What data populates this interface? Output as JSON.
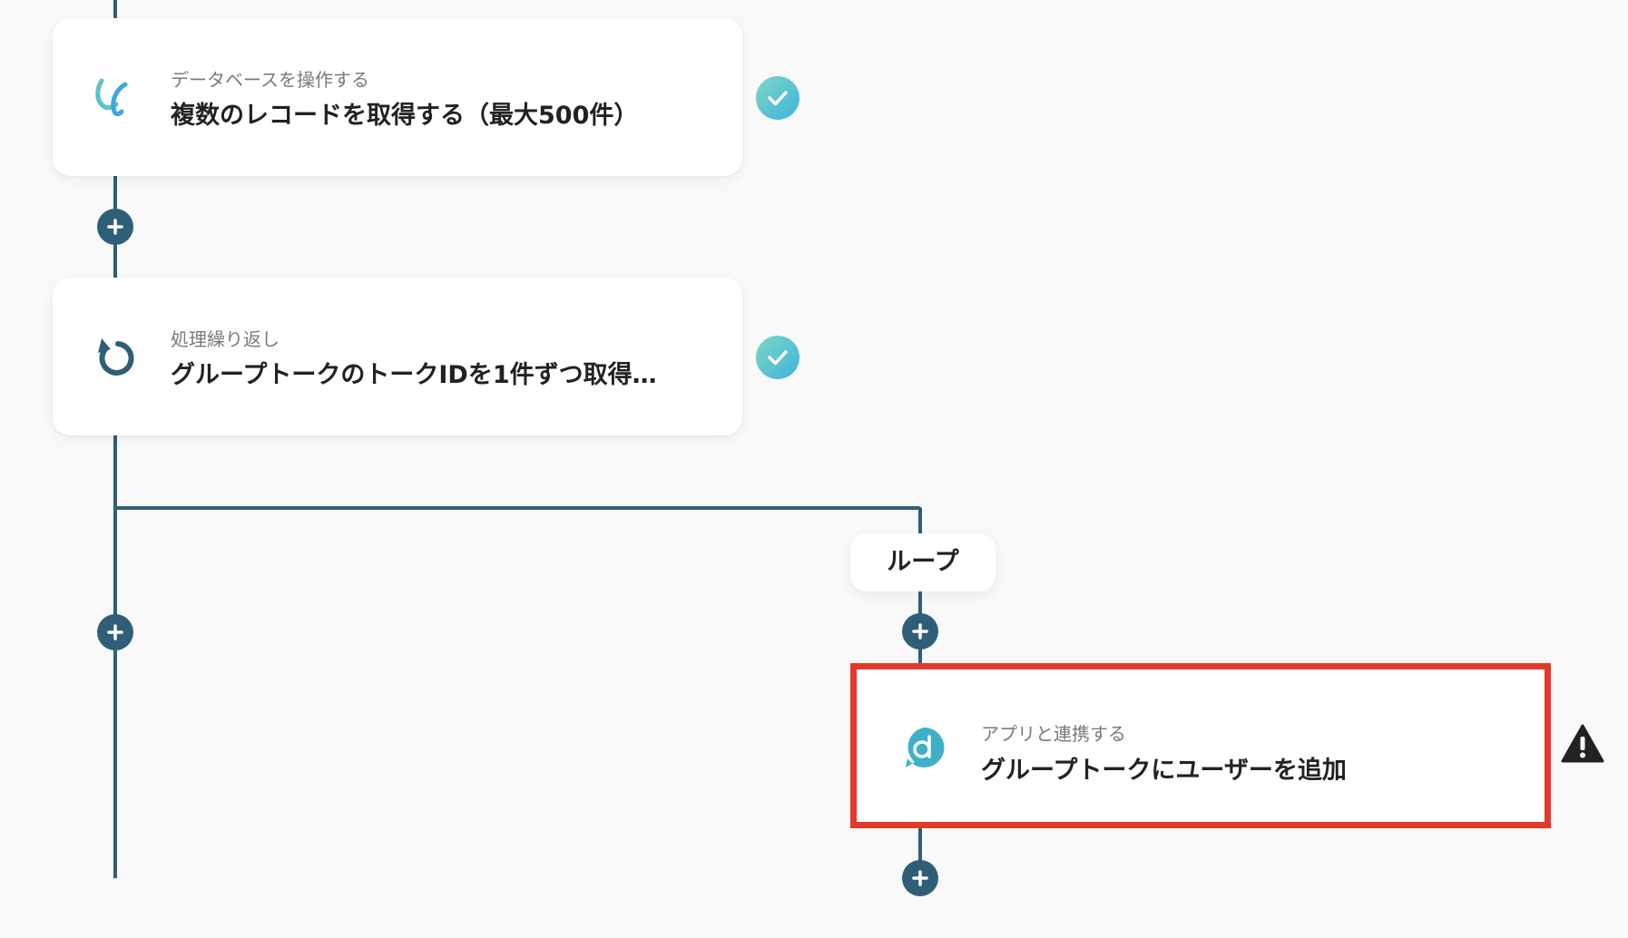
{
  "steps": [
    {
      "subtitle": "データベースを操作する",
      "title": "複数のレコードを取得する（最大500件）",
      "icon": "yoom-database-icon",
      "status": "completed"
    },
    {
      "subtitle": "処理繰り返し",
      "title": "グループトークのトークIDを1件ずつ取得…",
      "icon": "loop-arrow-icon",
      "status": "completed"
    }
  ],
  "branch": {
    "label": "ループ",
    "step": {
      "subtitle": "アプリと連携する",
      "title": "グループトークにユーザーを追加",
      "icon": "app-d-logo-icon",
      "status": "warning"
    }
  },
  "colors": {
    "connector": "#2f5f78",
    "highlight": "#e2392b",
    "check_start": "#7bd7c4",
    "check_end": "#3fb3dc"
  }
}
